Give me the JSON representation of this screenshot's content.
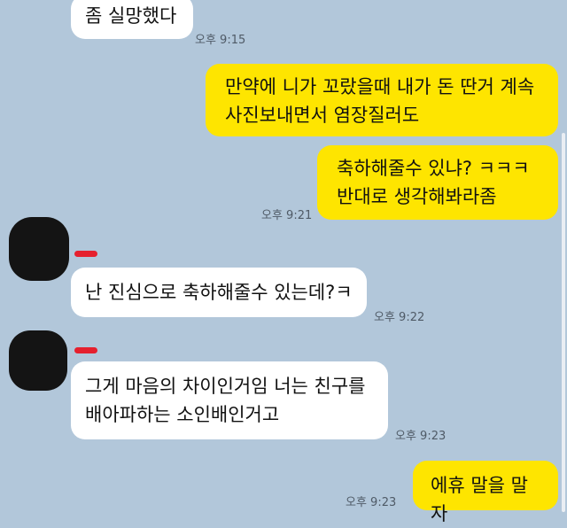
{
  "messages": [
    {
      "id": "m1",
      "sender": "other",
      "text": "좀 실망했다",
      "time": "오후 9:15"
    },
    {
      "id": "m2",
      "sender": "me",
      "text": "만약에 니가 꼬랐을때 내가 돈 딴거 계속\n사진보내면서 염장질러도",
      "time": ""
    },
    {
      "id": "m3",
      "sender": "me",
      "text": "축하해줄수 있냐? ㅋㅋㅋ\n반대로 생각해봐라좀",
      "time": "오후 9:21"
    },
    {
      "id": "m4",
      "sender": "other",
      "text": "난 진심으로 축하해줄수 있는데?ㅋ",
      "time": "오후 9:22"
    },
    {
      "id": "m5",
      "sender": "other",
      "text": "그게 마음의 차이인거임 너는 친구를\n배아파하는 소인배인거고",
      "time": "오후 9:23"
    },
    {
      "id": "m6",
      "sender": "me",
      "text": "에휴 말을 말자",
      "time": "오후 9:23"
    }
  ],
  "colors": {
    "background": "#b2c7da",
    "my_bubble": "#fee500",
    "their_bubble": "#ffffff",
    "time_text": "#4f5a66",
    "name_tag": "#e5202e"
  }
}
